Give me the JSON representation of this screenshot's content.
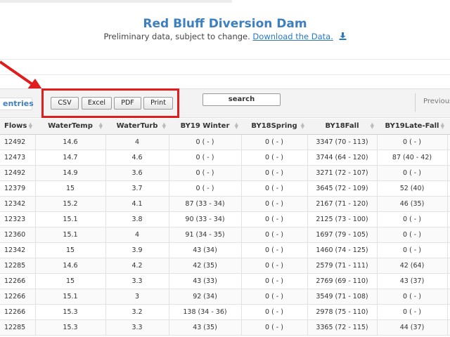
{
  "header": {
    "title": "Red Bluff Diversion Dam",
    "subtitle": "Preliminary data, subject to change.",
    "download_link": "Download the Data."
  },
  "toolbar": {
    "entries_label": "entries",
    "buttons": [
      "CSV",
      "Excel",
      "PDF",
      "Print"
    ],
    "search_label": "search",
    "previous_label": "Previous"
  },
  "colors": {
    "accent": "#3d7fbf",
    "highlight": "#e01c1c"
  },
  "table": {
    "columns": [
      "Flows",
      "WaterTemp",
      "WaterTurb",
      "BY19 Winter",
      "BY18Spring",
      "BY18Fall",
      "BY19Late-Fall"
    ],
    "rows": [
      [
        "12492",
        "14.6",
        "4",
        "0 ( - )",
        "0 ( - )",
        "3347 (70 - 113)",
        "0 ( - )"
      ],
      [
        "12473",
        "14.7",
        "4.6",
        "0 ( - )",
        "0 ( - )",
        "3744 (64 - 120)",
        "87 (40 - 42)"
      ],
      [
        "12492",
        "14.9",
        "3.6",
        "0 ( - )",
        "0 ( - )",
        "3271 (72 - 107)",
        "0 ( - )"
      ],
      [
        "12379",
        "15",
        "3.7",
        "0 ( - )",
        "0 ( - )",
        "3645 (72 - 109)",
        "52 (40)"
      ],
      [
        "12342",
        "15.2",
        "4.1",
        "87 (33 - 34)",
        "0 ( - )",
        "2167 (71 - 120)",
        "46 (35)"
      ],
      [
        "12323",
        "15.1",
        "3.8",
        "90 (33 - 34)",
        "0 ( - )",
        "2125 (73 - 100)",
        "0 ( - )"
      ],
      [
        "12360",
        "15.1",
        "4",
        "91 (34 - 35)",
        "0 ( - )",
        "1697 (79 - 105)",
        "0 ( - )"
      ],
      [
        "12342",
        "15",
        "3.9",
        "43 (34)",
        "0 ( - )",
        "1460 (74 - 125)",
        "0 ( - )"
      ],
      [
        "12285",
        "14.6",
        "4.2",
        "42 (35)",
        "0 ( - )",
        "2579 (71 - 111)",
        "42 (64)"
      ],
      [
        "12266",
        "15",
        "3.3",
        "43 (33)",
        "0 ( - )",
        "2769 (69 - 110)",
        "43 (37)"
      ],
      [
        "12266",
        "15.1",
        "3",
        "92 (34)",
        "0 ( - )",
        "3549 (71 - 108)",
        "0 ( - )"
      ],
      [
        "12266",
        "15.3",
        "3.2",
        "138 (34 - 36)",
        "0 ( - )",
        "2978 (75 - 110)",
        "0 ( - )"
      ],
      [
        "12285",
        "15.3",
        "3.3",
        "43 (35)",
        "0 ( - )",
        "3365 (72 - 115)",
        "44 (37)"
      ]
    ]
  }
}
